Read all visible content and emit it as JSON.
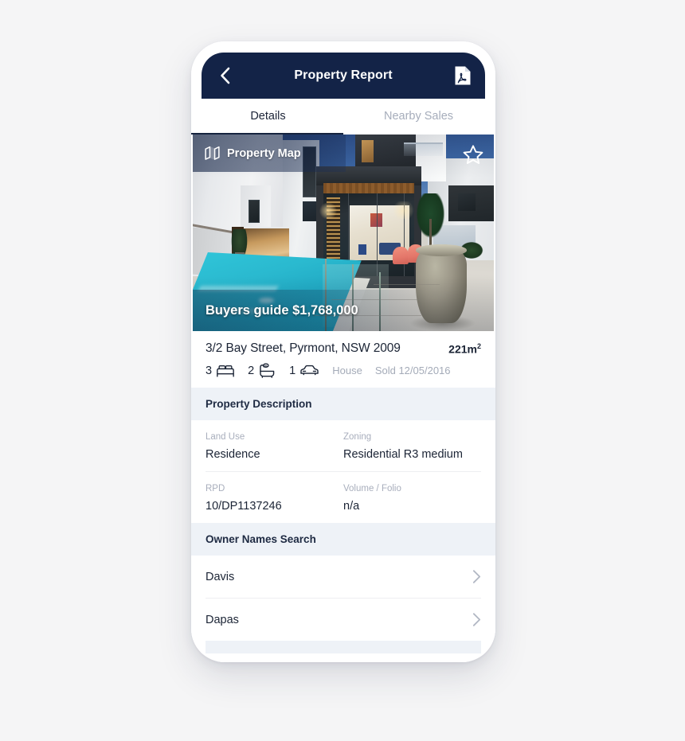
{
  "app": {
    "background_color": "#f5f5f6",
    "navy": "#132347",
    "section_bg": "#eef2f7"
  },
  "navbar": {
    "title": "Property Report",
    "back_icon": "chevron-left-icon",
    "pdf_icon": "pdf-document-icon"
  },
  "tabs": [
    {
      "label": "Details",
      "active": true
    },
    {
      "label": "Nearby Sales",
      "active": false
    }
  ],
  "hero": {
    "map_chip_label": "Property Map",
    "map_icon": "map-icon",
    "favorite_icon": "star-outline-icon",
    "price_label": "Buyers guide $1,768,000",
    "alt": "Modern two-storey house at dusk with lap pool, glass walls and warm interior lighting"
  },
  "property": {
    "address": "3/2 Bay Street, Pyrmont, NSW 2009",
    "area": "221m",
    "area_unit": "2",
    "features": [
      {
        "count": "3",
        "icon": "bed-icon",
        "name": "bedrooms"
      },
      {
        "count": "2",
        "icon": "bath-icon",
        "name": "bathrooms"
      },
      {
        "count": "1",
        "icon": "car-icon",
        "name": "car-spaces"
      }
    ],
    "type": "House",
    "sold": "Sold 12/05/2016"
  },
  "description": {
    "heading": "Property Description",
    "rows": [
      [
        {
          "label": "Land Use",
          "value": "Residence"
        },
        {
          "label": "Zoning",
          "value": "Residential R3 medium"
        }
      ],
      [
        {
          "label": "RPD",
          "value": "10/DP1137246"
        },
        {
          "label": "Volume / Folio",
          "value": "n/a"
        }
      ]
    ]
  },
  "owners": {
    "heading": "Owner Names Search",
    "items": [
      {
        "name": "Davis",
        "chevron": "chevron-right-icon"
      },
      {
        "name": "Dapas",
        "chevron": "chevron-right-icon"
      }
    ]
  }
}
